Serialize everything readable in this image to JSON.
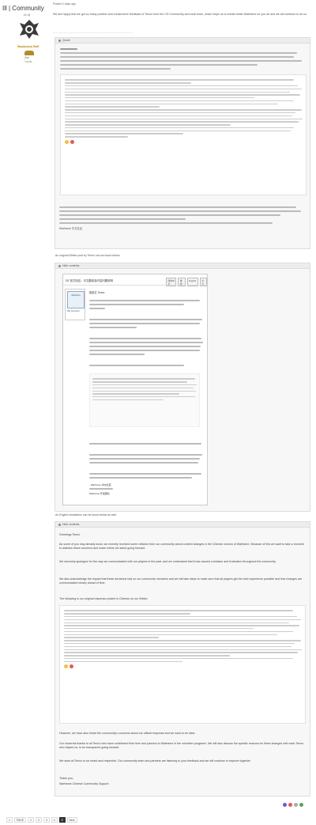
{
  "header": {
    "site_name": "Ill | Community",
    "username_sub": "Il2 dji"
  },
  "author": {
    "rank_label": "Waylan(mu) Staff",
    "stat_primary": "Gui",
    "stat_secondary": "7 posts"
  },
  "post": {
    "date": "Posted 2 days ago",
    "intro": "We are happy that we got so many positive and constructive feedback of Tenno from the CN Community and local team, which helps us to create better Warframe for you all and we will continue to do so.",
    "quote_label": "Quote",
    "quote_signoff": "Warframe 中文社区",
    "image_link": "An original Weibo post by Tenno can be found below.",
    "image_label": "Hide contents",
    "image_caption": "An English translation can be found below as well.",
    "translation_label": "Hide contents"
  },
  "doc": {
    "title": "DE 官方回应：中文翻译及内容问题说明",
    "tab_1": "简体中文",
    "tab_2": "繁體",
    "tab_3": "English",
    "tab_4": "分享",
    "sender": "Warframe",
    "sender_name": "DE_Kamenth",
    "greeting": "致各位 Tenno：",
    "sign_name": "- Warframe 中文社区",
    "sign_team": "Warframe 开发团队"
  },
  "translation": {
    "greeting": "Greetings Tenno",
    "p1": "As some of you may already know, we recently received some criticism from our community about content changes in the Chinese version of Warframe. Because of this we want to take a moment to address these concerns and share where we stand going forward.",
    "p2": "We sincerely apologize for the way we communicated with our players in the past, and we understand that it has caused confusion and frustration throughout the community.",
    "p3": "We also acknowledge the impact that these decisions had on our community members and we will take steps to make sure that all players get the best experience possible and that changes are communicated clearly ahead of time.",
    "p4": "The following is our original response posted in Chinese on our Weibo:",
    "p5": "However, we have also heard the community's concerns about our official response and we want to be clear:",
    "p6": "Our sincerest thanks to all Tenno who have contributed their time and passion to Warframe in the volunteer programs. We will also discuss the specific reasons for these changes with each Tenno who helped us, to be transparent going forward.",
    "p7": "We want all Tenno to be heard and respected. Our community team and partners are listening to your feedback and we will continue to improve together.",
    "closing": "Thank you,",
    "signature": "Warframe Chinese Community Support"
  },
  "pagination": {
    "prev": "«",
    "label": "PAGE",
    "pages": [
      "1",
      "2",
      "3",
      "4",
      "5"
    ],
    "current": "5",
    "next": "Next"
  },
  "colors": {
    "accent": "#b58b2a",
    "quote_bg": "#f7f7f7",
    "border": "#dddddd"
  }
}
